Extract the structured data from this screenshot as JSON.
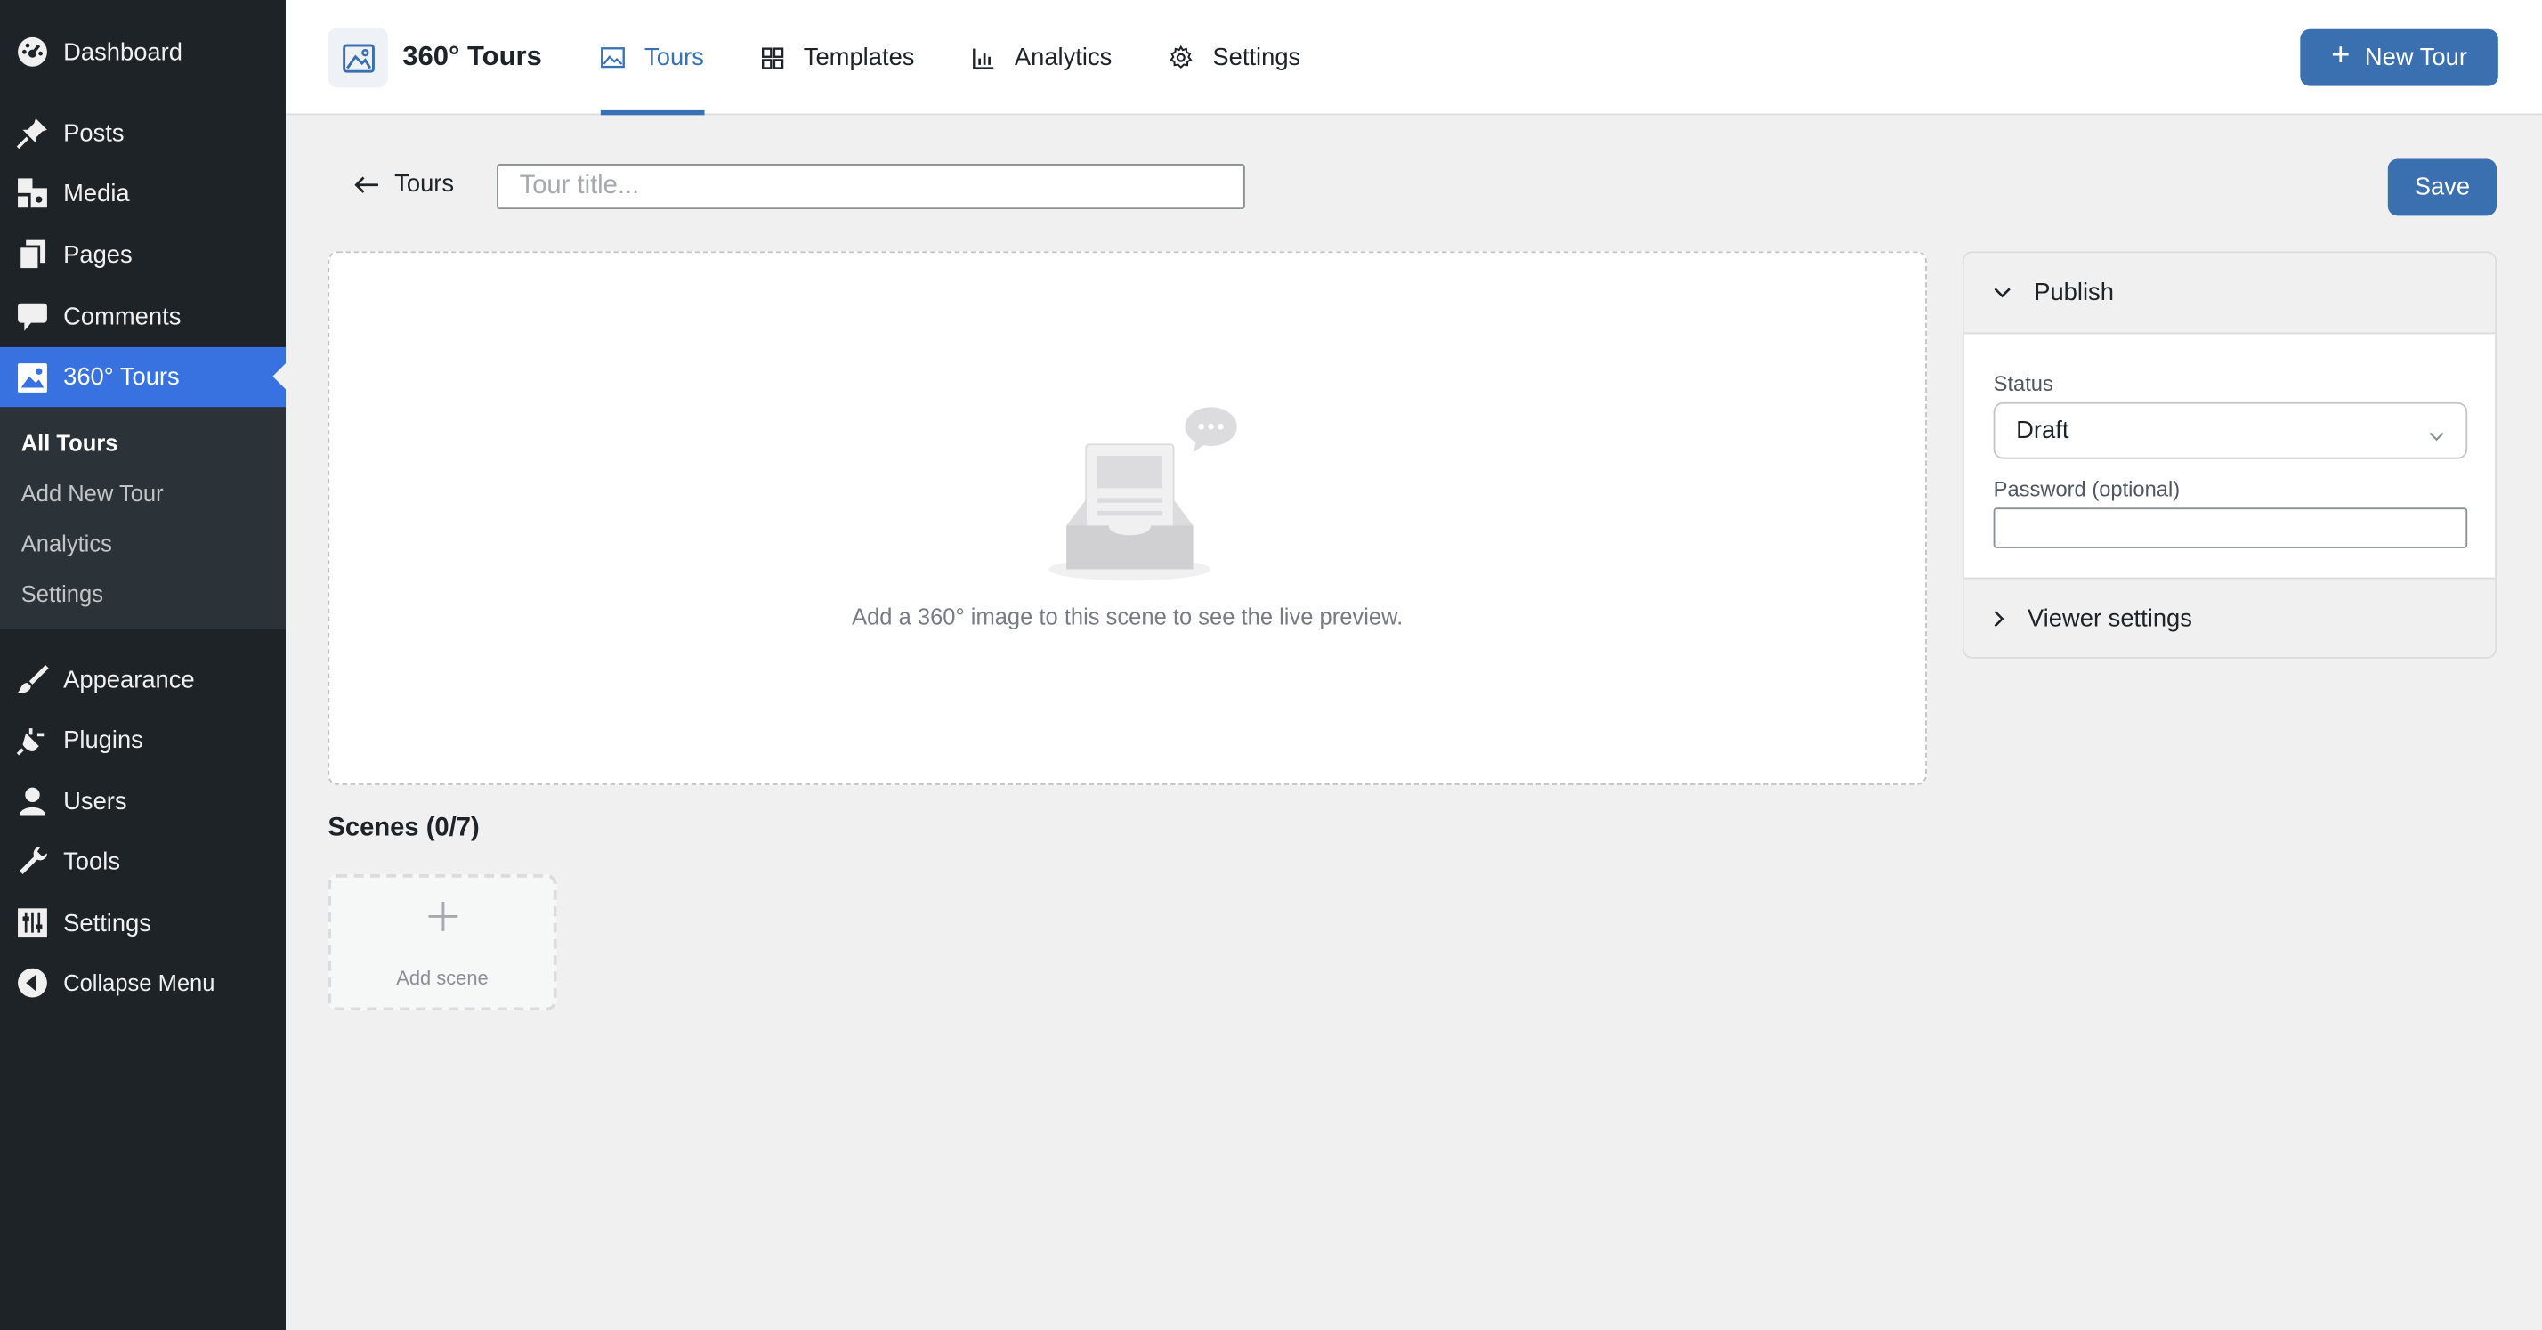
{
  "sidebar": {
    "items": [
      {
        "label": "Dashboard",
        "icon": "dashboard-icon"
      },
      {
        "label": "Posts",
        "icon": "pin-icon"
      },
      {
        "label": "Media",
        "icon": "media-icon"
      },
      {
        "label": "Pages",
        "icon": "pages-icon"
      },
      {
        "label": "Comments",
        "icon": "comment-icon"
      },
      {
        "label": "360° Tours",
        "icon": "image-icon",
        "active": true
      },
      {
        "label": "Appearance",
        "icon": "brush-icon"
      },
      {
        "label": "Plugins",
        "icon": "plug-icon"
      },
      {
        "label": "Users",
        "icon": "user-icon"
      },
      {
        "label": "Tools",
        "icon": "wrench-icon"
      },
      {
        "label": "Settings",
        "icon": "settings-icon"
      },
      {
        "label": "Collapse Menu",
        "icon": "collapse-icon"
      }
    ],
    "submenu": [
      {
        "label": "All Tours",
        "current": true
      },
      {
        "label": "Add New Tour"
      },
      {
        "label": "Analytics"
      },
      {
        "label": "Settings"
      }
    ]
  },
  "topbar": {
    "brand": "360° Tours",
    "tabs": [
      {
        "label": "Tours",
        "icon": "image-icon",
        "active": true
      },
      {
        "label": "Templates",
        "icon": "grid-icon"
      },
      {
        "label": "Analytics",
        "icon": "bar-chart-icon"
      },
      {
        "label": "Settings",
        "icon": "gear-icon"
      }
    ],
    "new_tour_label": "New Tour"
  },
  "editor": {
    "back_label": "Tours",
    "title_placeholder": "Tour title...",
    "save_label": "Save",
    "preview_message": "Add a 360° image to this scene to see the live preview.",
    "scenes_heading": "Scenes (0/7)",
    "add_scene_label": "Add scene"
  },
  "panel": {
    "publish_label": "Publish",
    "status_label": "Status",
    "status_value": "Draft",
    "password_label": "Password (optional)",
    "viewer_settings_label": "Viewer settings"
  },
  "colors": {
    "sidebar_bg": "#1d2327",
    "accent": "#3872e0",
    "button": "#3a6fb0",
    "active_tab": "#3872b5"
  }
}
